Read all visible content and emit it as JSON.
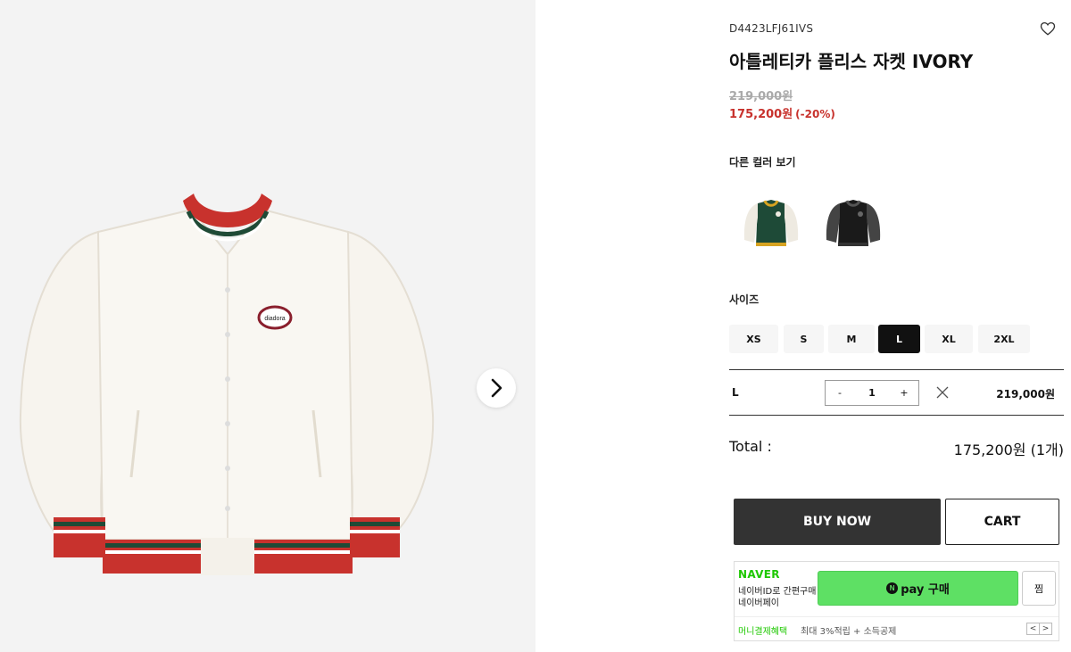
{
  "product": {
    "sku": "D4423LFJ61IVS",
    "title": "아틀레티카 플리스 자켓 IVORY",
    "original_price": "219,000원",
    "sale_price": "175,200원",
    "discount": "(-20%)",
    "image_logo_text": "diadora"
  },
  "colors": {
    "label": "다른 컬러 보기",
    "swatches": [
      "green-varsity-jacket",
      "black-varsity-jacket"
    ]
  },
  "sizes": {
    "label": "사이즈",
    "options": [
      "XS",
      "S",
      "M",
      "L",
      "XL",
      "2XL"
    ],
    "selected": "L"
  },
  "selected_option": {
    "size": "L",
    "qty_minus": "-",
    "quantity": "1",
    "qty_plus": "+",
    "price": "219,000원"
  },
  "total": {
    "label": "Total :",
    "value": "175,200원 (1개)"
  },
  "actions": {
    "buy_now": "BUY NOW",
    "cart": "CART"
  },
  "naver_pay": {
    "brand": "NAVER",
    "line1": "네이버ID로 간편구매",
    "line2": "네이버페이",
    "n_logo": "N",
    "pay_label": "pay 구매",
    "zzim": "찜",
    "benefit_label": "머니결제혜택",
    "benefit_desc": "최대 3%적립 + 소득공제",
    "prev": "<",
    "next": ">"
  },
  "colors_theme": {
    "sale_red": "#c8322d",
    "naver_green": "#1ec800",
    "npay_button": "#5ee064",
    "buy_button": "#333333"
  }
}
